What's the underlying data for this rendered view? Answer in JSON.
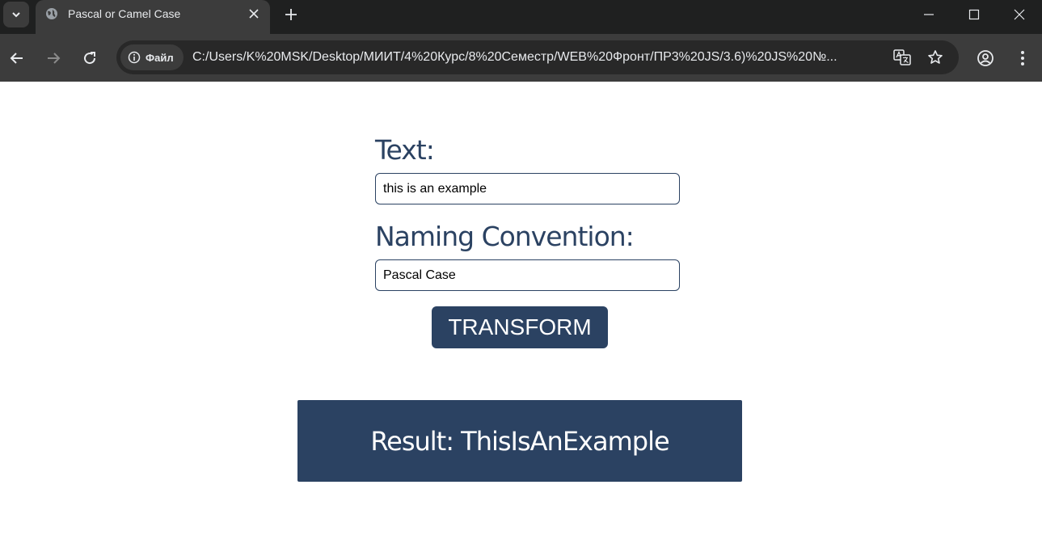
{
  "browser": {
    "tab": {
      "title": "Pascal or Camel Case"
    },
    "address_bar": {
      "site_chip": "Файл",
      "url": "C:/Users/K%20MSK/Desktop/МИИТ/4%20Курс/8%20Семестр/WEB%20Фронт/ПР3%20JS/3.6)%20JS%20№..."
    }
  },
  "page": {
    "text_label": "Text:",
    "text_input_value": "this is an example",
    "convention_label": "Naming Convention:",
    "convention_value": "Pascal Case",
    "transform_button": "TRANSFORM",
    "result": "Result: ThisIsAnExample"
  },
  "colors": {
    "primary": "#2b4262",
    "chrome_dark": "#1f2020",
    "chrome_toolbar": "#3c3c3c"
  }
}
